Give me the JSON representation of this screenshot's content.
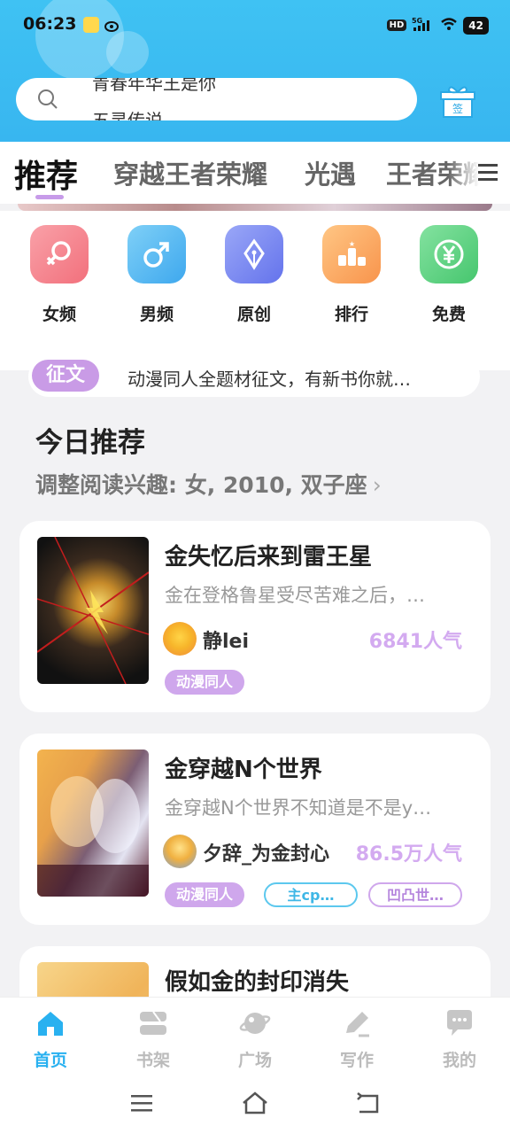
{
  "status_bar": {
    "time": "06:23",
    "network": "5G",
    "hd": "HD",
    "battery": "42"
  },
  "search": {
    "hint_line1": "青春年华王是你",
    "hint_line2": "五灵传说"
  },
  "gift": {
    "label": "签"
  },
  "tabs": [
    {
      "label": "推荐",
      "active": true
    },
    {
      "label": "穿越王者荣耀"
    },
    {
      "label": "光遇"
    },
    {
      "label": "王者荣耀"
    }
  ],
  "quick_entries": [
    {
      "label": "女频",
      "icon": "female-icon",
      "color": "#f47c86"
    },
    {
      "label": "男频",
      "icon": "male-icon",
      "color": "#4db4f0"
    },
    {
      "label": "原创",
      "icon": "pen-nib-icon",
      "color": "#6f7ef0"
    },
    {
      "label": "排行",
      "icon": "podium-icon",
      "color": "#f9a25c"
    },
    {
      "label": "免费",
      "icon": "yuan-icon",
      "color": "#58cf80"
    }
  ],
  "notice": {
    "tag": "征文",
    "text": "动漫同人全题材征文，有新书你就…"
  },
  "section": {
    "title": "今日推荐",
    "subtitle": "调整阅读兴趣: 女, 2010, 双子座"
  },
  "books": [
    {
      "title": "金失忆后来到雷王星",
      "desc": "金在登格鲁星受尽苦难之后，…",
      "author": "静lei",
      "popularity": "6841人气",
      "tags": [
        "动漫同人"
      ]
    },
    {
      "title": "金穿越N个世界",
      "desc": "金穿越N个世界不知道是不是y…",
      "author": "夕辞_为金封心",
      "popularity": "86.5万人气",
      "tags": [
        "动漫同人",
        "主cp…",
        "凹凸世…"
      ]
    },
    {
      "title": "假如金的封印消失"
    }
  ],
  "bottom_nav": [
    {
      "label": "首页",
      "icon": "home-icon",
      "active": true
    },
    {
      "label": "书架",
      "icon": "bookshelf-icon"
    },
    {
      "label": "广场",
      "icon": "planet-icon"
    },
    {
      "label": "写作",
      "icon": "write-icon"
    },
    {
      "label": "我的",
      "icon": "chat-bubble-icon"
    }
  ],
  "colors": {
    "brand": "#3fc2f3",
    "accent_purple": "#cfa7ec",
    "active_nav": "#29b1f0"
  }
}
